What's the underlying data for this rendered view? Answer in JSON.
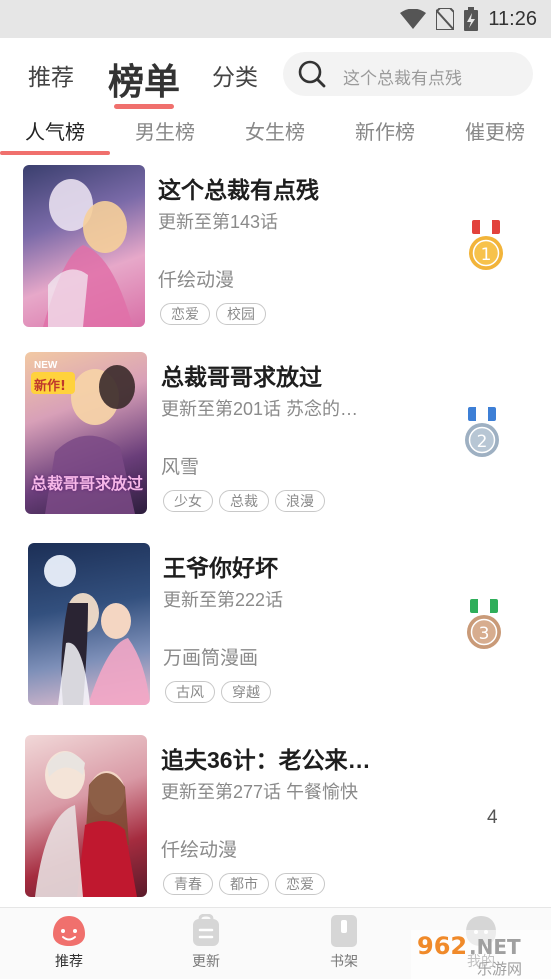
{
  "status_bar": {
    "time": "11:26",
    "icons": [
      "wifi-icon",
      "no-sim-icon",
      "battery-charging-icon"
    ]
  },
  "top_tabs": [
    {
      "label": "推荐",
      "active": false
    },
    {
      "label": "榜单",
      "active": true
    },
    {
      "label": "分类",
      "active": false
    }
  ],
  "search": {
    "placeholder": "这个总裁有点残"
  },
  "rank_tabs": [
    {
      "label": "人气榜",
      "active": true
    },
    {
      "label": "男生榜",
      "active": false
    },
    {
      "label": "女生榜",
      "active": false
    },
    {
      "label": "新作榜",
      "active": false
    },
    {
      "label": "催更榜",
      "active": false
    }
  ],
  "items": [
    {
      "title": "这个总裁有点残",
      "update": "更新至第143话",
      "author": "仟绘动漫",
      "tags": [
        "恋爱",
        "校园"
      ],
      "rank": "1",
      "medal": "gold"
    },
    {
      "title": "总裁哥哥求放过",
      "update": "更新至第201话 苏念的…",
      "author": "风雪",
      "tags": [
        "少女",
        "总裁",
        "浪漫"
      ],
      "rank": "2",
      "medal": "silver",
      "cover_badge": "新作!",
      "cover_badge_top": "NEW",
      "cover_text": "总裁哥哥求放过"
    },
    {
      "title": "王爷你好坏",
      "update": "更新至第222话",
      "author": "万画筒漫画",
      "tags": [
        "古风",
        "穿越"
      ],
      "rank": "3",
      "medal": "bronze"
    },
    {
      "title": "追夫36计：老公来…",
      "update": "更新至第277话 午餐愉快",
      "author": "仟绘动漫",
      "tags": [
        "青春",
        "都市",
        "恋爱"
      ],
      "rank": "4"
    }
  ],
  "bottom_nav": [
    {
      "label": "推荐",
      "icon": "smile-icon",
      "active": true
    },
    {
      "label": "更新",
      "icon": "update-bag-icon",
      "active": false
    },
    {
      "label": "书架",
      "icon": "bookshelf-icon",
      "active": false
    },
    {
      "label": "我的",
      "icon": "profile-icon",
      "active": false
    }
  ],
  "watermark": "962.NET 乐游网",
  "colors": {
    "accent": "#f0706d",
    "gold": "#f2b43a",
    "silver": "#9eb0c2",
    "bronze": "#c99a78"
  }
}
